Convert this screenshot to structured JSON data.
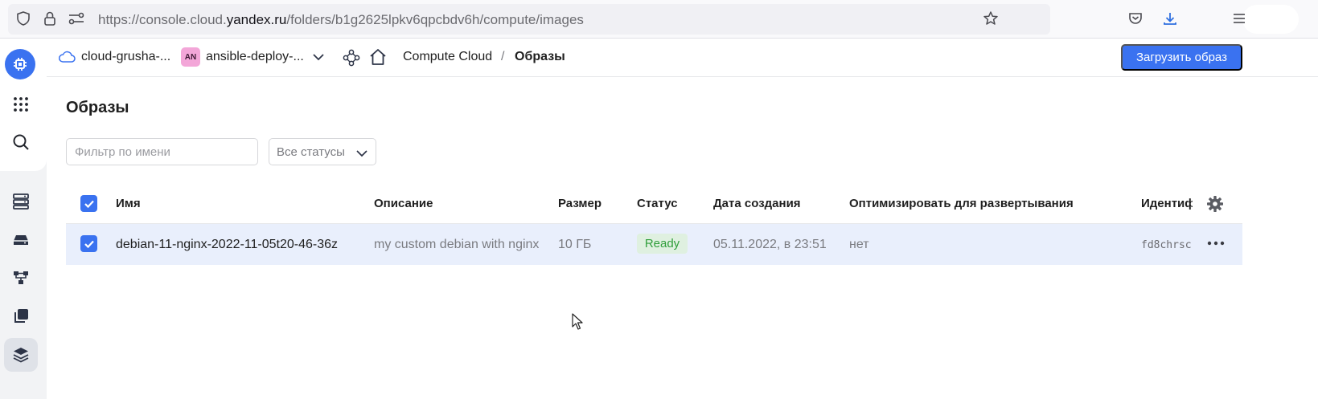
{
  "browser": {
    "url_prefix": "https://console.cloud.",
    "url_domain": "yandex.ru",
    "url_path": "/folders/b1g2625lpkv6qpcbdv6h/compute/images"
  },
  "header": {
    "cloud_name": "cloud-grusha-...",
    "folder_badge": "AN",
    "folder_name": "ansible-deploy-...",
    "breadcrumb_service": "Compute Cloud",
    "breadcrumb_sep": "/",
    "breadcrumb_current": "Образы",
    "upload_button": "Загрузить образ"
  },
  "page": {
    "title": "Образы",
    "filter_placeholder": "Фильтр по имени",
    "status_filter": "Все статусы"
  },
  "table": {
    "columns": {
      "name": "Имя",
      "description": "Описание",
      "size": "Размер",
      "status": "Статус",
      "created": "Дата создания",
      "optimize": "Оптимизировать для развертывания",
      "id": "Идентиф"
    },
    "rows": [
      {
        "name": "debian-11-nginx-2022-11-05t20-46-36z",
        "description": "my custom debian with nginx",
        "size": "10 ГБ",
        "status": "Ready",
        "created": "05.11.2022, в 23:51",
        "optimize": "нет",
        "id": "fd8chrsc"
      }
    ]
  },
  "colors": {
    "accent": "#3a72f0",
    "selected_row": "#e9effc",
    "status_ready_bg": "#dff0e0",
    "status_ready_text": "#2f9e3a"
  }
}
